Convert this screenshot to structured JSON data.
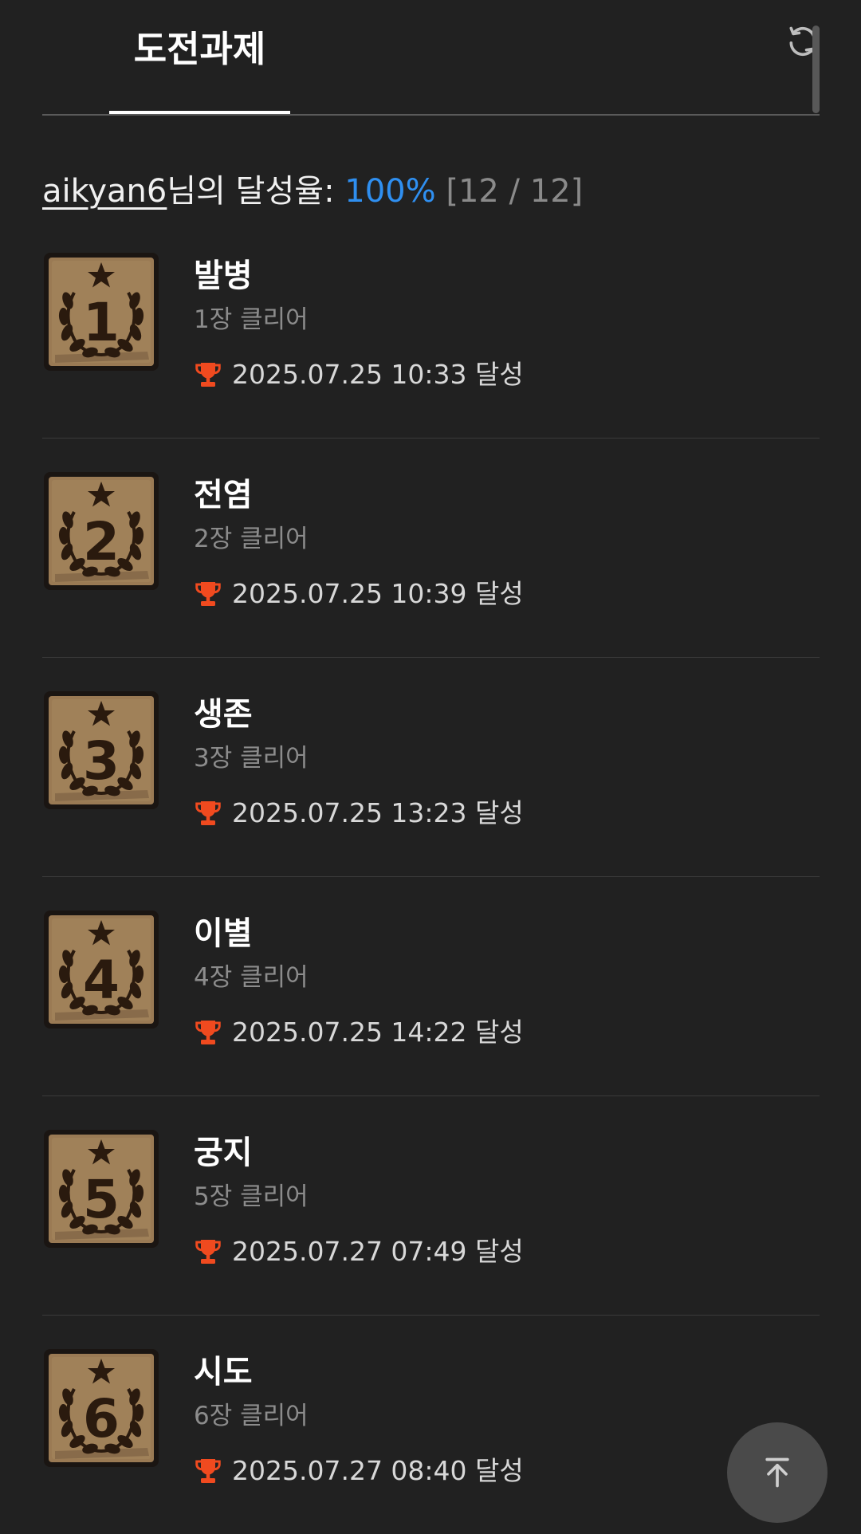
{
  "header": {
    "tab_label": "도전과제"
  },
  "summary": {
    "username": "aikyan6",
    "label_suffix": "님의 달성율: ",
    "rate": "100%",
    "count": " [12 / 12]"
  },
  "colors": {
    "background": "#212121",
    "accent_blue": "#2f8ff0",
    "trophy": "#f04a1f",
    "badge_paper": "#9a7a54",
    "badge_ink": "#2a1a0e"
  },
  "achievements": [
    {
      "badge_number": "1",
      "title": "발병",
      "subtitle": "1장 클리어",
      "date": "2025.07.25 10:33 달성"
    },
    {
      "badge_number": "2",
      "title": "전염",
      "subtitle": "2장 클리어",
      "date": "2025.07.25 10:39 달성"
    },
    {
      "badge_number": "3",
      "title": "생존",
      "subtitle": "3장 클리어",
      "date": "2025.07.25 13:23 달성"
    },
    {
      "badge_number": "4",
      "title": "이별",
      "subtitle": "4장 클리어",
      "date": "2025.07.25 14:22 달성"
    },
    {
      "badge_number": "5",
      "title": "궁지",
      "subtitle": "5장 클리어",
      "date": "2025.07.27 07:49 달성"
    },
    {
      "badge_number": "6",
      "title": "시도",
      "subtitle": "6장 클리어",
      "date": "2025.07.27 08:40 달성"
    }
  ],
  "icons": {
    "refresh": "refresh-icon",
    "trophy": "trophy-icon",
    "scroll_top": "arrow-up-to-line-icon"
  }
}
